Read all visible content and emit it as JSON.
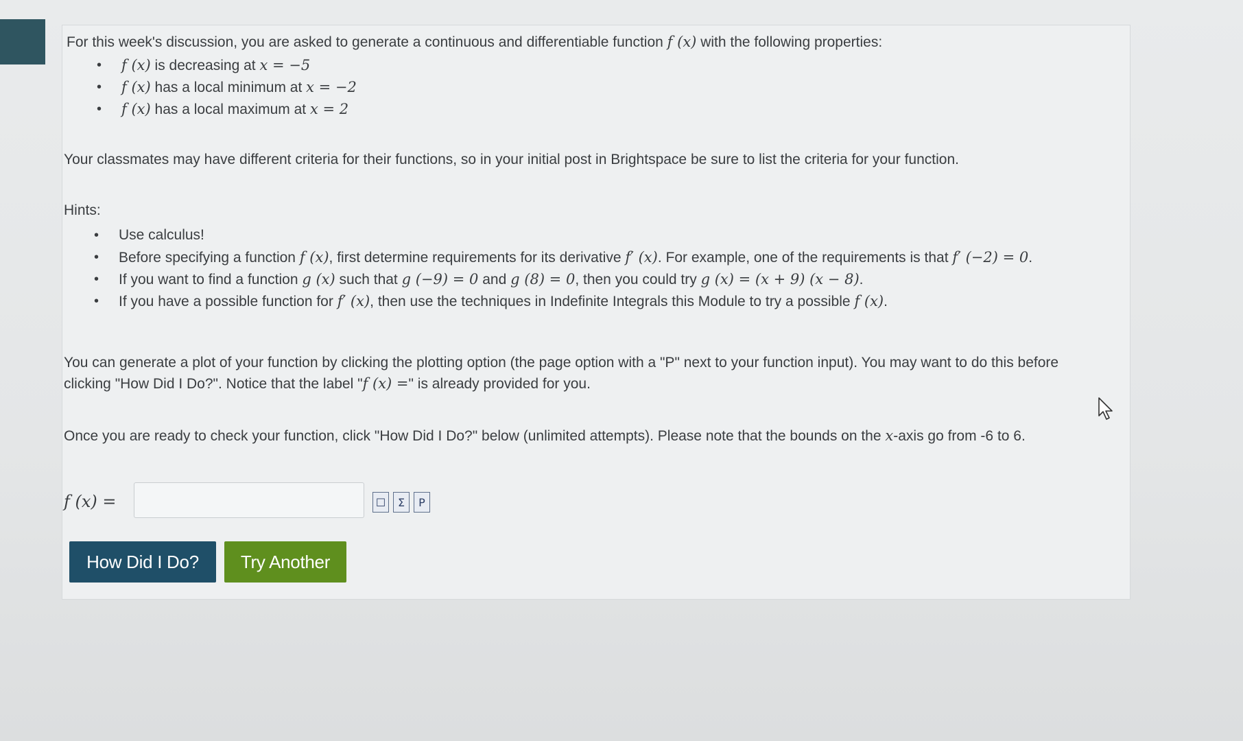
{
  "intro": {
    "line": "For this week's discussion, you are asked to generate a continuous and differentiable function",
    "fx": "f (x)",
    "tail": "with the following properties:"
  },
  "properties": [
    {
      "fx": "f (x)",
      "text": "is decreasing at",
      "math": "x = −5"
    },
    {
      "fx": "f (x)",
      "text": "has a local minimum at",
      "math": "x = −2"
    },
    {
      "fx": "f (x)",
      "text": "has a local maximum at",
      "math": "x = 2"
    }
  ],
  "classmates_note": "Your classmates may have different criteria for their functions, so in your initial post in Brightspace be sure to list the criteria for your function.",
  "hints": {
    "heading": "Hints:",
    "h1": "Use calculus!",
    "h2": {
      "a": "Before specifying a function",
      "fx": "f (x)",
      "b": ", first determine requirements for its derivative",
      "fpx": "f′ (x)",
      "c": ". For example, one of the requirements is that",
      "req": "f′ (−2) = 0",
      "d": "."
    },
    "h3": {
      "a": "If you want to find a function",
      "gx": "g (x)",
      "b": "such that",
      "g1": "g (−9) = 0",
      "c": "and",
      "g2": "g (8) = 0",
      "d": ", then you could try",
      "g3": "g (x) = (x + 9) (x − 8)",
      "e": "."
    },
    "h4": {
      "a": "If you have a possible function for",
      "fpx": "f′ (x)",
      "b": ", then use the techniques in Indefinite Integrals this Module to try a possible",
      "fx": "f (x)",
      "c": "."
    }
  },
  "plot_note": {
    "line1": "You can generate a plot of your function by clicking the plotting option (the page option with a \"P\" next to your function input). You may want to do this before",
    "line2a": "clicking \"How Did I Do?\". Notice that the label \"",
    "line2fx": "f (x) =",
    "line2b": "\" is already provided for you."
  },
  "check_note": {
    "a": "Once you are ready to check your function, click \"How Did I Do?\" below (unlimited attempts). Please note that the bounds on the",
    "x": "x",
    "b": "-axis go from -6 to 6."
  },
  "answer": {
    "label": "f (x) =",
    "value": "",
    "placeholder": ""
  },
  "tools": [
    "☐",
    "Σ",
    "P"
  ],
  "buttons": {
    "how": "How Did I Do?",
    "try": "Try Another"
  },
  "colors": {
    "how": "#1f4f68",
    "try": "#5f8f1e",
    "side_tab": "#2f5560"
  }
}
